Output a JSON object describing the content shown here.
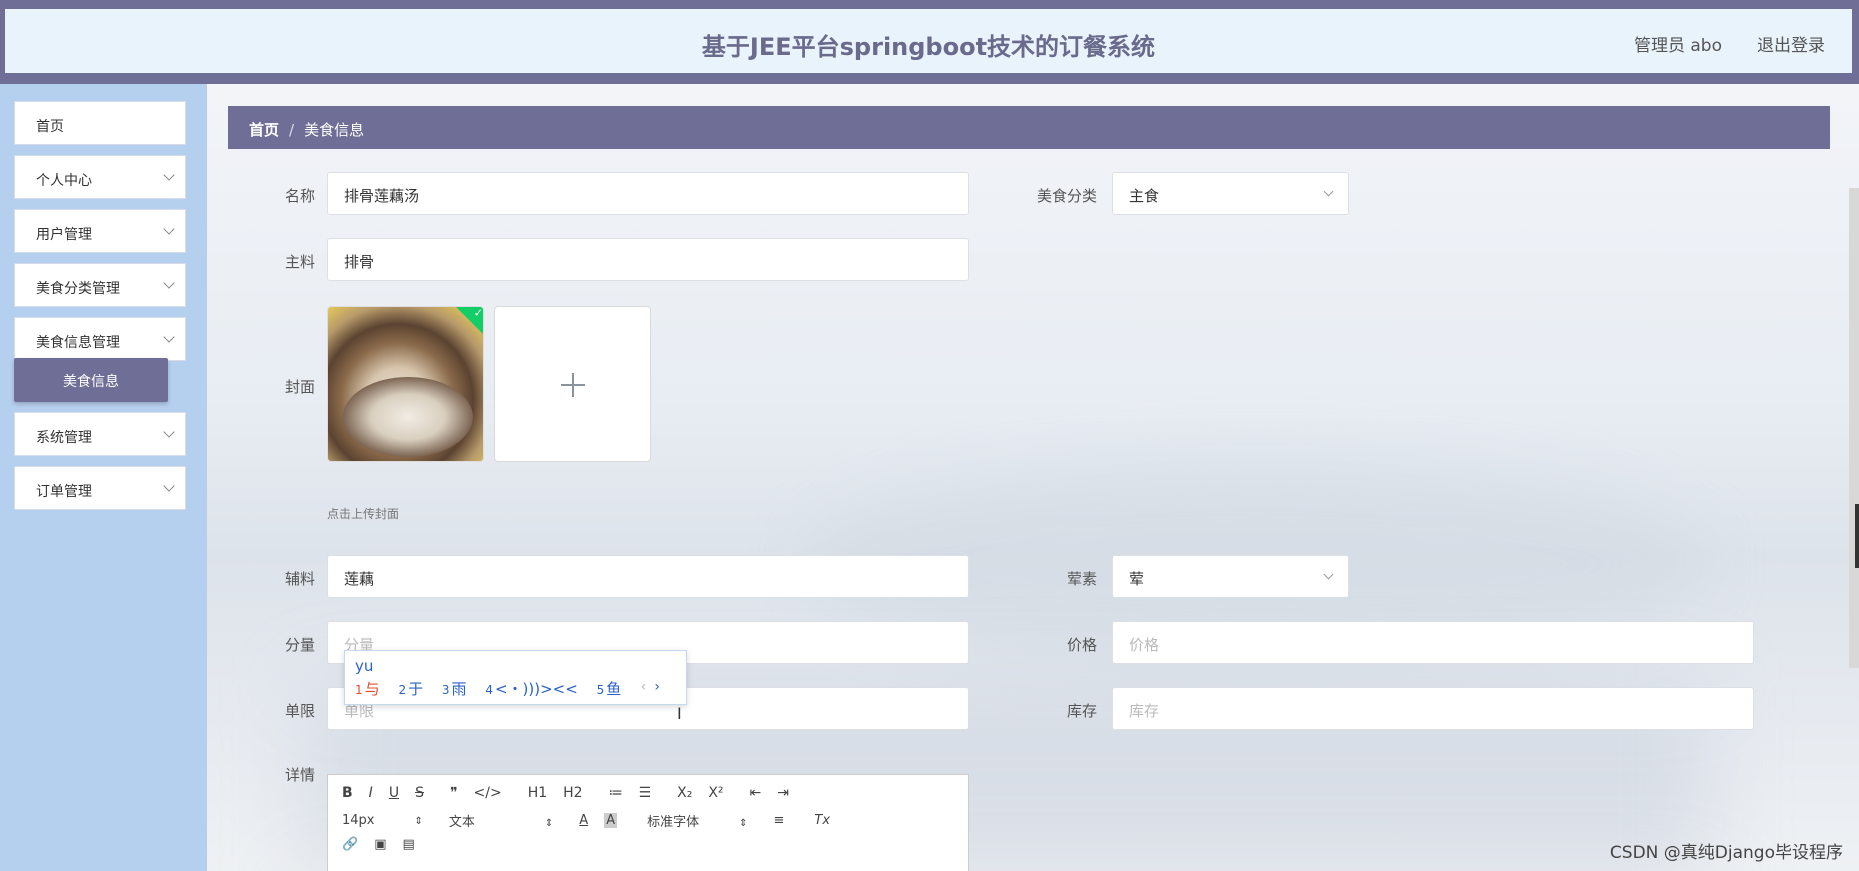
{
  "header": {
    "title": "基于JEE平台springboot技术的订餐系统",
    "admin": "管理员 abo",
    "logout": "退出登录"
  },
  "sidebar": {
    "items": [
      {
        "label": "首页",
        "has_chevron": false
      },
      {
        "label": "个人中心",
        "has_chevron": true
      },
      {
        "label": "用户管理",
        "has_chevron": true
      },
      {
        "label": "美食分类管理",
        "has_chevron": true
      },
      {
        "label": "美食信息管理",
        "has_chevron": true
      },
      {
        "label": "系统管理",
        "has_chevron": true
      },
      {
        "label": "订单管理",
        "has_chevron": true
      }
    ],
    "active_sub": "美食信息"
  },
  "breadcrumb": {
    "home": "首页",
    "separator": "/",
    "current": "美食信息"
  },
  "form": {
    "name": {
      "label": "名称",
      "value": "排骨莲藕汤"
    },
    "category": {
      "label": "美食分类",
      "value": "主食"
    },
    "main_ingredient": {
      "label": "主料",
      "value": "排骨"
    },
    "cover": {
      "label": "封面",
      "hint": "点击上传封面"
    },
    "side_ingredient": {
      "label": "辅料",
      "value": "莲藕"
    },
    "meat_veg": {
      "label": "荤素",
      "value": "荤"
    },
    "portion": {
      "label": "分量",
      "placeholder": "分量"
    },
    "price": {
      "label": "价格",
      "placeholder": "价格"
    },
    "limit": {
      "label": "单限",
      "placeholder": "单限"
    },
    "stock": {
      "label": "库存",
      "placeholder": "库存"
    },
    "details": {
      "label": "详情"
    }
  },
  "ime": {
    "typed": "yu",
    "candidates": [
      {
        "n": "1",
        "text": "与"
      },
      {
        "n": "2",
        "text": "于"
      },
      {
        "n": "3",
        "text": "雨"
      },
      {
        "n": "4",
        "text": "<・)))><<"
      },
      {
        "n": "5",
        "text": "鱼"
      }
    ],
    "prev": "‹",
    "next": "›"
  },
  "editor": {
    "row1": [
      "B",
      "I",
      "U",
      "S",
      "❞",
      "</>",
      "H1",
      "H2",
      "≔",
      "☰",
      "X₂",
      "X²",
      "⇤",
      "⇥"
    ],
    "font_size": "14px",
    "header_select": "文本",
    "font_family": "标准字体",
    "row2_icons": [
      "A",
      "A",
      "≡",
      "Tx"
    ],
    "row3": [
      "🔗",
      "▣",
      "▤"
    ]
  },
  "watermark": "CSDN @真纯Django毕设程序",
  "colors": {
    "accent": "#6e6e96",
    "sidebar": "#b5cfee",
    "header_bg": "#e9f3fb"
  }
}
